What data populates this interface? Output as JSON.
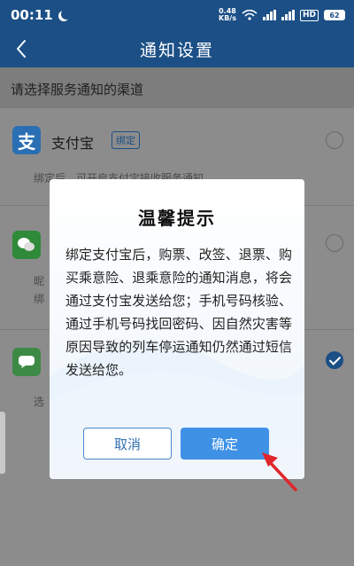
{
  "status_bar": {
    "time": "00:11",
    "net_speed_value": "0.48",
    "net_speed_unit": "KB/s",
    "hd_label": "HD",
    "battery": "62"
  },
  "nav": {
    "title": "通知设置"
  },
  "section_header": "请选择服务通知的渠道",
  "list": {
    "alipay": {
      "name": "支付宝",
      "badge": "绑定",
      "desc": "绑定后，可开启支付宝接收服务通知",
      "icon": "alipay-icon"
    },
    "wechat": {
      "icon": "wechat-icon",
      "desc1": "昵",
      "desc2": "绑"
    },
    "sms": {
      "icon": "sms-icon",
      "desc": "选"
    }
  },
  "dialog": {
    "title": "温馨提示",
    "body": "绑定支付宝后，购票、改签、退票、购买乘意险、退乘意险的通知消息，将会通过支付宝发送给您；手机号码核验、通过手机号码找回密码、因自然灾害等原因导致的列车停运通知仍然通过短信发送给您。",
    "cancel_label": "取消",
    "ok_label": "确定"
  },
  "colors": {
    "primary": "#1b4f86",
    "button_blue": "#3f91e6",
    "arrow_red": "#e0262b"
  }
}
